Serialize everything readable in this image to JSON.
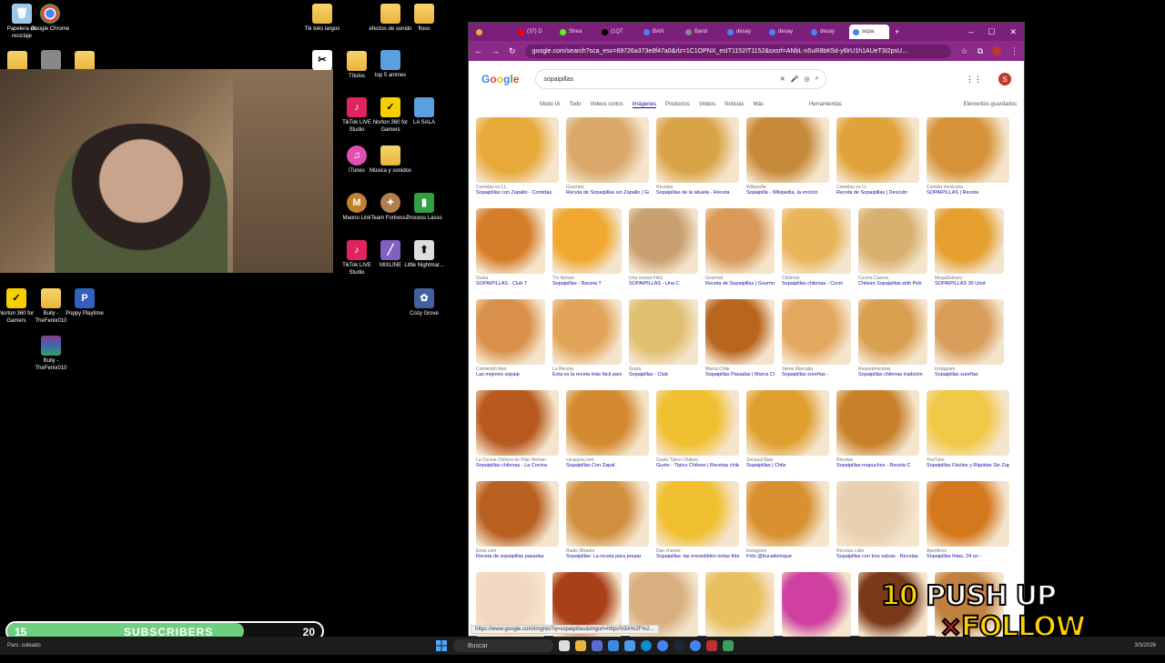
{
  "desktop": {
    "left_icons": [
      {
        "label": "Papelera de reciclaje",
        "icon": "recycle-bin-icon",
        "color": "#9fc7e8"
      },
      {
        "label": "Google Chrome",
        "icon": "chrome-icon",
        "color": "#4285f4"
      },
      {
        "label": "",
        "icon": "folder-icon",
        "color": "#e8b53b"
      },
      {
        "label": "",
        "icon": "app-icon",
        "color": "#888888"
      },
      {
        "label": "",
        "icon": "folder-icon",
        "color": "#e8b53b"
      }
    ],
    "bottom_left_icons": [
      {
        "label": "Norton 360 for Gamers",
        "icon": "norton-icon",
        "color": "#f5d000"
      },
      {
        "label": "Bully - TheFenix010",
        "icon": "folder-icon",
        "color": "#e8b53b"
      },
      {
        "label": "Poppy Playtime",
        "icon": "poppy-icon",
        "color": "#3060c0"
      },
      {
        "label": "Bully - TheFenix010",
        "icon": "winrar-icon",
        "color": "#8b3a8b"
      }
    ],
    "middle_icons": [
      {
        "label": "Tik toks largos",
        "icon": "folder-icon",
        "color": "#e8b53b"
      },
      {
        "label": "efectos de sonido",
        "icon": "folder-icon",
        "color": "#e8b53b"
      },
      {
        "label": "ftoso",
        "icon": "folder-icon",
        "color": "#e8b53b"
      },
      {
        "label": "",
        "icon": "capcut-icon",
        "color": "#ffffff"
      },
      {
        "label": "Títulos",
        "icon": "folder-icon",
        "color": "#e8b53b"
      },
      {
        "label": "top 5 animes",
        "icon": "document-icon",
        "color": "#5aa0e0"
      },
      {
        "label": "TikTok LIVE Studio",
        "icon": "tiktok-icon",
        "color": "#e0245e"
      },
      {
        "label": "Norton 360 for Gamers",
        "icon": "norton-icon",
        "color": "#f5d000"
      },
      {
        "label": "LA SALA",
        "icon": "document-icon",
        "color": "#5aa0e0"
      },
      {
        "label": "iTunes",
        "icon": "itunes-icon",
        "color": "#e04fb0"
      },
      {
        "label": "Música y sonidos",
        "icon": "folder-icon",
        "color": "#e8b53b"
      },
      {
        "label": "Maono Link",
        "icon": "maono-icon",
        "color": "#c08030"
      },
      {
        "label": "Team Fortress...",
        "icon": "tf2-icon",
        "color": "#b08050"
      },
      {
        "label": "Process Lasso",
        "icon": "lasso-icon",
        "color": "#30a040"
      },
      {
        "label": "TikTok LIVE Studio",
        "icon": "tiktok-icon",
        "color": "#e0245e"
      },
      {
        "label": "MIXLINE",
        "icon": "mixline-icon",
        "color": "#8060c0"
      },
      {
        "label": "Little Nightmar...",
        "icon": "document-icon",
        "color": "#dddddd"
      },
      {
        "label": "Cozy Grove",
        "icon": "cozy-icon",
        "color": "#4060a0"
      }
    ]
  },
  "browser": {
    "tabs": [
      {
        "label": ""
      },
      {
        "label": "(37) D"
      },
      {
        "label": "Strea"
      },
      {
        "label": "(1QT"
      },
      {
        "label": "BAN"
      },
      {
        "label": "Band"
      },
      {
        "label": "desay"
      },
      {
        "label": "desay"
      },
      {
        "label": "desay"
      },
      {
        "label": "sopa"
      }
    ],
    "url": "google.com/search?sca_esv=69726a373e8f47a0&rlz=1C1OPNX_esIT1152IT1152&sxsrf=ANbL-n5uR8bK5d-y6lrU1h1AUeT3I2psU...",
    "search_query": "sopaipillas",
    "filters": [
      "Modo IA",
      "Todo",
      "Videos cortos",
      "Imágenes",
      "Productos",
      "Videos",
      "Noticias",
      "Más"
    ],
    "active_filter": "Imágenes",
    "tools_label": "Herramientas",
    "saved_label": "Elementos guardados",
    "avatar_letter": "S",
    "status_url": "https://www.google.com/imgres?q=sopaipillas&imgurl=https%3A%2F%2..."
  },
  "results": [
    [
      {
        "src": "Comidas en LL",
        "cap": "Sopaipillas con Zapallo - Comidas",
        "color": "#e6a93a"
      },
      {
        "src": "Gourmet",
        "cap": "Receta de Sopaipillas sin Zapallo | Gour",
        "color": "#d9a86a"
      },
      {
        "src": "Recetas",
        "cap": "Sopaipillas de la abuela - Receta",
        "color": "#d9a447"
      },
      {
        "src": "Wikipedia",
        "cap": "Sopaipilla - Wikipedia, la enciclo",
        "color": "#c78a3a"
      },
      {
        "src": "Comidas en LL",
        "cap": "Receta de Sopaipillas | Descubr",
        "color": "#e0a23a"
      },
      {
        "src": "Comida mexicana",
        "cap": "SOPAIPILLAS | Receta",
        "color": "#d7933a"
      }
    ],
    [
      {
        "src": "Gusta",
        "cap": "SOPAIPILLAS - Club T",
        "color": "#d67d2a"
      },
      {
        "src": "Tío Nelson",
        "cap": "Sopaipillas - Receta T",
        "color": "#f0a830"
      },
      {
        "src": "Una cocina Feliz",
        "cap": "SOPAIPILLAS - Una C",
        "color": "#c9a070"
      },
      {
        "src": "Gourmet",
        "cap": "Receta de Sopaipillas | Gourmet",
        "color": "#d99a5a"
      },
      {
        "src": "Chilenas",
        "cap": "Sopaipillas chilenas - Cocin",
        "color": "#e8b55a"
      },
      {
        "src": "Cocina Casera",
        "cap": "Chilean Sopaipillas with Peb",
        "color": "#d8b070"
      },
      {
        "src": "MegaDelivery",
        "cap": "SOPAIPILLAS 30 Unid",
        "color": "#e5a030"
      }
    ],
    [
      {
        "src": "Comiendo bien",
        "cap": "Las mejores sopaip",
        "color": "#d9904a"
      },
      {
        "src": "La Receta",
        "cap": "Esta es la receta más fácil para hacer",
        "color": "#e2a458"
      },
      {
        "src": "Gusta",
        "cap": "Sopaipillas - Club",
        "color": "#e0c070"
      },
      {
        "src": "Marca Chile",
        "cap": "Sopaipillas Pasadas | Marca Chile",
        "color": "#b8651e"
      },
      {
        "src": "Jaime Marcado",
        "cap": "Sopaipillas sureñas -",
        "color": "#e3a860"
      },
      {
        "src": "Requeterecetas",
        "cap": "Sopaipillas chilenas tradición",
        "color": "#d9a050"
      },
      {
        "src": "Instagram",
        "cap": "Sopaipillas sureñas",
        "color": "#d89e5a"
      }
    ],
    [
      {
        "src": "La Cocina Chilena de Pilar Hernan",
        "cap": "Sopaipillas chilenas - La Cocina",
        "color": "#b85a20"
      },
      {
        "src": "cocacpia.com",
        "cap": "Sopaipillas Con Zapal",
        "color": "#d48a30"
      },
      {
        "src": "Gusto Tipico Chileno",
        "cap": "Gusto - Típico Chileno | Recetas chilenas",
        "color": "#f0c030"
      },
      {
        "src": "Sensual Baio",
        "cap": "Sopaipillas | Chile",
        "color": "#e0a030"
      },
      {
        "src": "Recetas",
        "cap": "Sopaipillas mapuches - Receta C",
        "color": "#c8802a"
      },
      {
        "src": "YouTube",
        "cap": "Sopaipillas Fáciles y Rápidas Sin Zapallo",
        "color": "#f2c848"
      }
    ],
    [
      {
        "src": "Emol.com",
        "cap": "Receta de sopaipillas pasadas",
        "color": "#b86020"
      },
      {
        "src": "Radio Mirador",
        "cap": "Sopaipillas: La receta para prepar",
        "color": "#d09040"
      },
      {
        "src": "Dan cheese",
        "cap": "Sopaipillas: las irresistibles tortas fritas",
        "color": "#f0c030"
      },
      {
        "src": "Instagram",
        "cap": "Fritz @bucalismique",
        "color": "#d89030"
      },
      {
        "src": "Recetas Lider",
        "cap": "Sopaipillas con tres salsas - Recetas Lider",
        "color": "#e8d0b0"
      },
      {
        "src": "Aperitivos",
        "cap": "Sopaipillas fritas, 24 un -",
        "color": "#d4781e"
      }
    ],
    [
      {
        "src": "",
        "cap": "",
        "color": "#f2d8c0"
      },
      {
        "src": "",
        "cap": "",
        "color": "#a8401a"
      },
      {
        "src": "",
        "cap": "",
        "color": "#d8b080"
      },
      {
        "src": "",
        "cap": "",
        "color": "#e8c060"
      },
      {
        "src": "",
        "cap": "",
        "color": "#d040a0"
      },
      {
        "src": "",
        "cap": "",
        "color": "#7a3a1a"
      },
      {
        "src": "",
        "cap": "",
        "color": "#c08040"
      }
    ]
  ],
  "subscribers": {
    "current": "15",
    "label": "SUBSCRIBERS",
    "goal": "20",
    "progress_fraction": 0.75,
    "fill_color": "#6fcf7f"
  },
  "promo": {
    "line1_num": "10",
    "line1_text": " PUSH UP",
    "line2_x": "×",
    "line2_text": "FOLLOW"
  },
  "taskbar": {
    "weather": "Parc. soleado",
    "search_placeholder": "Buscar",
    "clock": "3/3/2026"
  }
}
